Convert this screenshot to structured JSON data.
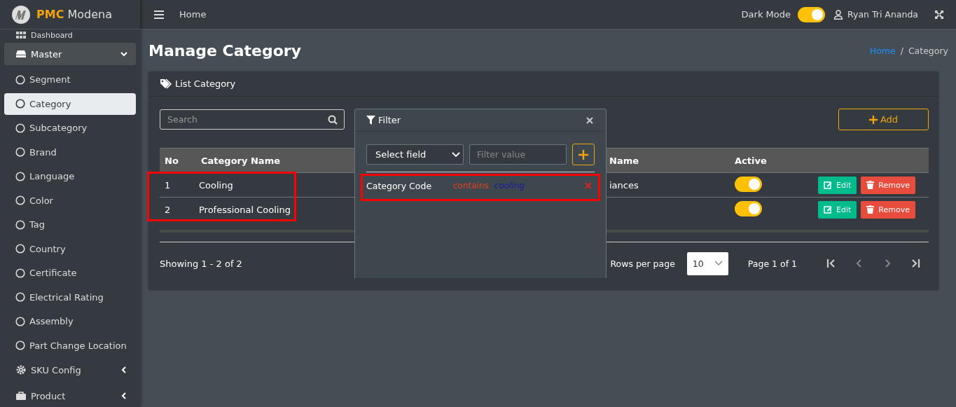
{
  "brand": {
    "strong": "PMC",
    "rest": "Modena"
  },
  "topbar": {
    "link": "Home",
    "dark_mode": {
      "label": "Dark Mode",
      "on": true
    },
    "user": "Ryan Tri Ananda"
  },
  "sidebar": {
    "items": [
      {
        "label": "Dashboard",
        "kind": "link"
      },
      {
        "label": "Master",
        "kind": "group",
        "expanded": true,
        "children": [
          {
            "label": "Segment",
            "selected": false
          },
          {
            "label": "Category",
            "selected": true
          },
          {
            "label": "Subcategory",
            "selected": false
          },
          {
            "label": "Brand",
            "selected": false
          },
          {
            "label": "Language",
            "selected": false
          },
          {
            "label": "Color",
            "selected": false
          },
          {
            "label": "Tag",
            "selected": false
          },
          {
            "label": "Country",
            "selected": false
          },
          {
            "label": "Certificate",
            "selected": false
          },
          {
            "label": "Electrical Rating",
            "selected": false
          },
          {
            "label": "Assembly",
            "selected": false
          },
          {
            "label": "Part Change Location",
            "selected": false
          }
        ]
      },
      {
        "label": "SKU Config",
        "kind": "group",
        "expanded": false
      },
      {
        "label": "Product",
        "kind": "group",
        "expanded": false
      }
    ]
  },
  "page": {
    "title": "Manage Category",
    "breadcrumb": [
      {
        "label": "Home",
        "kind": "link"
      },
      {
        "label": "/",
        "kind": "separator"
      },
      {
        "label": "Category",
        "kind": "current"
      }
    ]
  },
  "card": {
    "title": "List Category",
    "search": {
      "placeholder": "Search"
    },
    "add_button": "Add",
    "table": {
      "columns": [
        "No",
        "Category Name",
        "Name",
        "Active"
      ],
      "rows": [
        {
          "no": "1",
          "name": "Cooling",
          "column_3": "iances",
          "active": true,
          "actions": [
            "Edit",
            "Remove"
          ]
        },
        {
          "no": "2",
          "name": "Professional Cooling",
          "active": true,
          "actions": [
            "Edit",
            "Remove"
          ]
        }
      ]
    },
    "footer": {
      "showing": "Showing 1 - 2 of 2",
      "rows_label": "Rows per page",
      "rows_value": "10",
      "page": "Page 1 of 1"
    }
  },
  "filter": {
    "title": "Filter",
    "field_select": "Select field",
    "value_placeholder": "Filter value",
    "rules": [
      {
        "field": "Category Code",
        "operator": "contains",
        "value": "cooling"
      }
    ]
  }
}
